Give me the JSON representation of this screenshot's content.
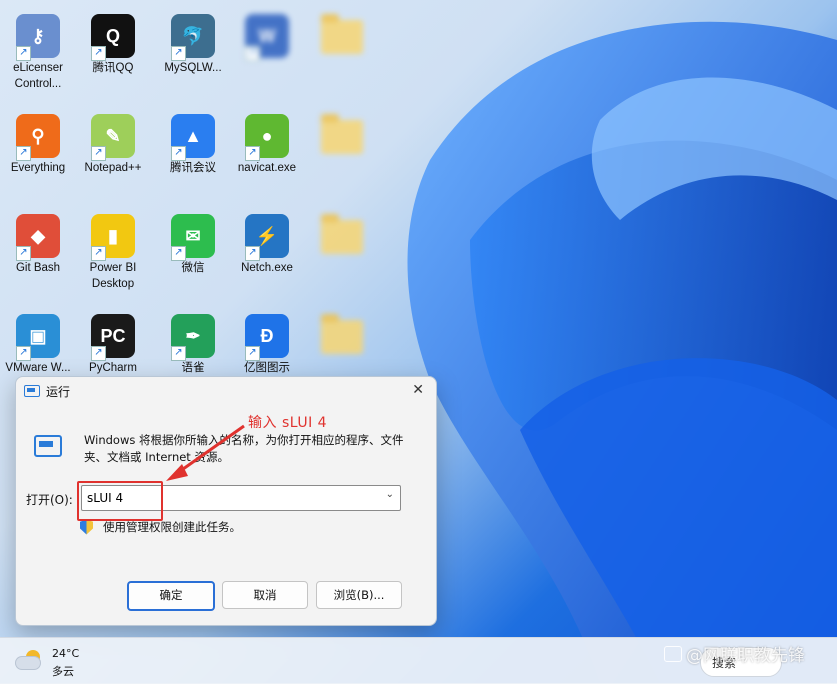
{
  "desktop_icons": [
    {
      "label": "eLicenser Control...",
      "color": "#6a8fcf",
      "glyph": "⚷"
    },
    {
      "label": "腾讯QQ",
      "color": "#111111",
      "glyph": "Q"
    },
    {
      "label": "MySQLW...",
      "color": "#3d6e8f",
      "glyph": "🐬"
    },
    {
      "label": "",
      "color": "#2b5fbf",
      "glyph": "W"
    },
    {
      "label": "Everything",
      "color": "#ef6b1a",
      "glyph": "⚲"
    },
    {
      "label": "Notepad++",
      "color": "#9ecf5a",
      "glyph": "✎"
    },
    {
      "label": "腾讯会议",
      "color": "#2a7ef0",
      "glyph": "▲"
    },
    {
      "label": "navicat.exe",
      "color": "#5fb831",
      "glyph": "●"
    },
    {
      "label": "Git Bash",
      "color": "#e04e39",
      "glyph": "◆"
    },
    {
      "label": "Power BI Desktop",
      "color": "#f2c811",
      "glyph": "▮"
    },
    {
      "label": "微信",
      "color": "#2dbd4e",
      "glyph": "✉"
    },
    {
      "label": "Netch.exe",
      "color": "#2575c4",
      "glyph": "⚡"
    },
    {
      "label": "VMware W...",
      "color": "#2a8fd6",
      "glyph": "▣"
    },
    {
      "label": "PyCharm",
      "color": "#1a1a1a",
      "glyph": "PC"
    },
    {
      "label": "语雀",
      "color": "#23a05a",
      "glyph": "✒"
    },
    {
      "label": "亿图图示",
      "color": "#1f73e8",
      "glyph": "Ð"
    }
  ],
  "folders": [
    "",
    "",
    "",
    ""
  ],
  "run_dialog": {
    "title": "运行",
    "description": "Windows 将根据你所输入的名称，为你打开相应的程序、文件夹、文档或 Internet 资源。",
    "open_label": "打开(O):",
    "open_value": "sLUI 4",
    "admin_note": "使用管理权限创建此任务。",
    "ok_label": "确定",
    "cancel_label": "取消",
    "browse_label": "浏览(B)..."
  },
  "annotation": {
    "text": "输入  sLUI 4",
    "color": "#e0322e"
  },
  "taskbar": {
    "temperature": "24°C",
    "condition": "多云",
    "search_label": "搜索"
  },
  "watermark": "@网联职教先锋"
}
